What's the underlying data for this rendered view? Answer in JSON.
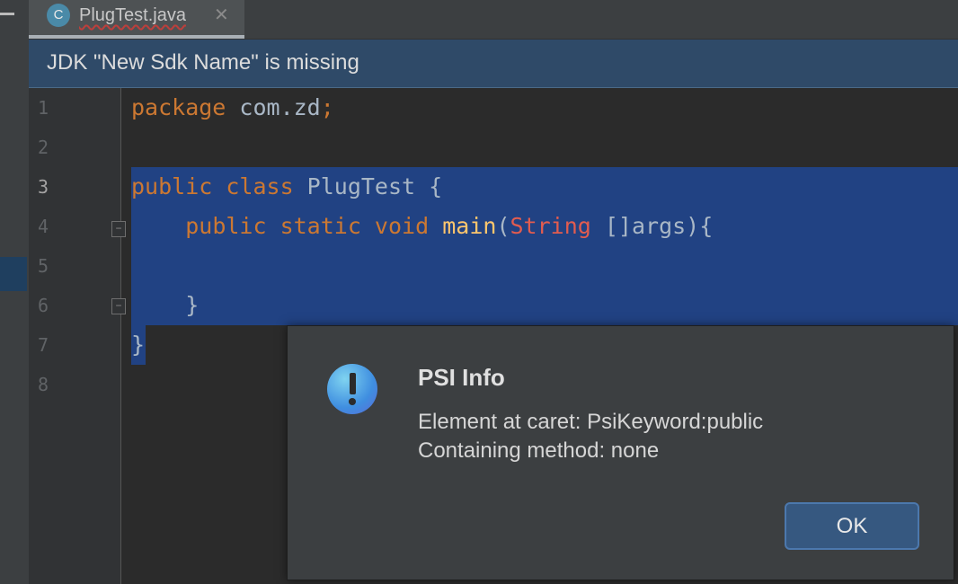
{
  "tab": {
    "icon_letter": "C",
    "file_name": "PlugTest.java",
    "close_glyph": "✕"
  },
  "banner": {
    "text": "JDK \"New Sdk Name\" is missing"
  },
  "editor": {
    "line_numbers": [
      "1",
      "2",
      "3",
      "4",
      "5",
      "6",
      "7",
      "8"
    ],
    "current_line": 3
  },
  "dialog": {
    "title": "PSI Info",
    "line1": "Element at caret: PsiKeyword:public",
    "line2": "Containing method: none",
    "ok_label": "OK"
  },
  "colors": {
    "selection": "#214283",
    "keyword": "#cc7832",
    "method": "#ffc66d",
    "banner": "#2f4a68",
    "ok_button": "#365880"
  }
}
